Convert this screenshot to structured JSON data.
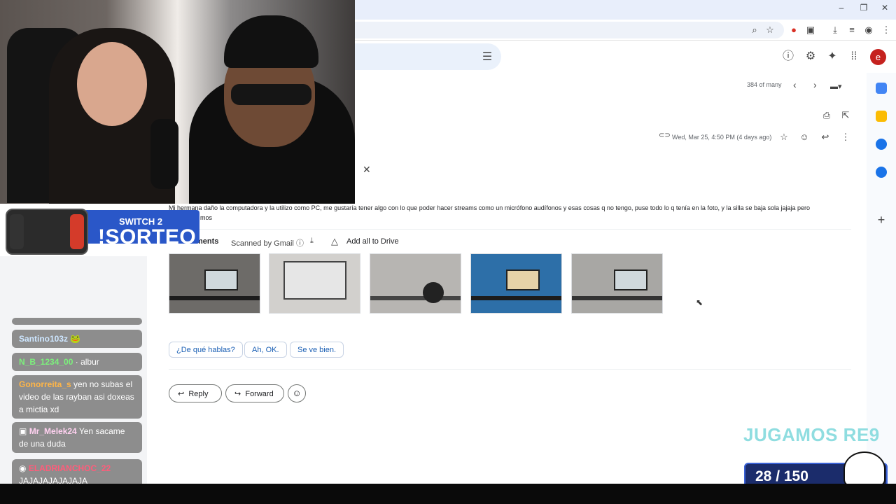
{
  "browser": {
    "window_controls": {
      "minimize": "–",
      "restore": "❐",
      "close": "✕"
    },
    "toolbar_icons": [
      "zoom-icon",
      "star-icon",
      "extension-badge-icon",
      "puzzle-icon",
      "download-icon",
      "playlist-icon",
      "profile-icon",
      "kebab-icon"
    ]
  },
  "gmail_header": {
    "tune_glyph": "⚙",
    "help_glyph": "?",
    "settings_glyph": "⚙",
    "gemini_glyph": "✦",
    "apps_glyph": "⋮⋮",
    "avatar_letter": "e"
  },
  "mail": {
    "pager": "384 of many",
    "date": "Wed, Mar 25, 4:50 PM (4 days ago)",
    "body": "Mi hermana daño la computadora y la utilizo como PC, me gustaría tener algo con lo que poder hacer streams como un micrófono audífonos y esas cosas q no tengo, puse todo lo q tenía en la foto, y la silla se baja sola jajaja pero",
    "body_cont": "mos",
    "attachments_title": "ments",
    "scanned": "Scanned by Gmail",
    "add_drive": "Add all to Drive",
    "attachment_count": 5,
    "smart_replies": [
      "¿De qué hablas?",
      "Ah, OK.",
      "Se ve bien."
    ],
    "reply_label": "Reply",
    "forward_label": "Forward"
  },
  "stream": {
    "switch2_label": "SWITCH 2",
    "sorteo_label": "!SORTEO",
    "chat": [
      {
        "user": "Santino103z",
        "user_color": "#cde6ff",
        "text": ""
      },
      {
        "user": "N_B_1234_00",
        "user_color": "#7cf07c",
        "text": "· albur"
      },
      {
        "user": "Gonorreita_s",
        "user_color": "#ffb547",
        "text": "yen no subas el video de las rayban asi doxeas a mictia xd"
      },
      {
        "user": "Mr_Melek24",
        "user_color": "#ffd1f0",
        "text": "Yen sacame de una duda"
      },
      {
        "user": "ELADRIANCHOC_22",
        "user_color": "#ff5c7a",
        "text": "JAJAJAJAJAJAJA"
      }
    ],
    "jugamos": "JUGAMOS RE9",
    "counter": "28 / 150"
  },
  "colors": {
    "accent_blue": "#1a5fb4",
    "avatar_red": "#c5221f",
    "sorteo_blue": "#2a57c8"
  }
}
